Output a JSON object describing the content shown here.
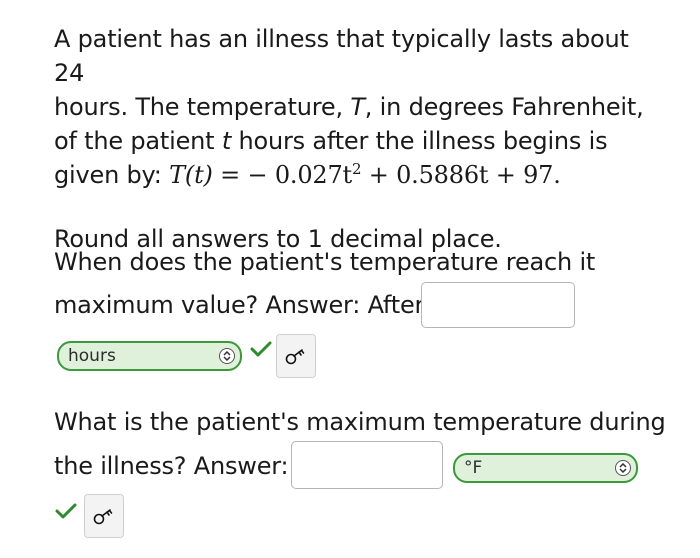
{
  "problem": {
    "line1": "A patient has an illness that typically lasts about 24",
    "line2": "hours. The temperature, ",
    "line2_var": "T",
    "line2_end": ", in degrees Fahrenheit,",
    "line3_start": "of the patient ",
    "line3_var": "t",
    "line3_end": " hours after the illness begins is",
    "line4_start": "given by: ",
    "formula_lhs": "T(t)",
    "formula_eq": " = ",
    "formula_part1": "− 0.027t",
    "formula_exp": "2",
    "formula_part2": " + 0.5886t + 97."
  },
  "instruction": "Round all answers to 1 decimal place.",
  "question1": {
    "line1": "When does the patient's temperature reach it",
    "line2": "maximum value? Answer: After",
    "answer_value": "",
    "unit_selected": "hours"
  },
  "question2": {
    "line1": "What is the patient's maximum temperature during",
    "line2": "the illness? Answer:",
    "answer_value": "",
    "unit_selected": "°F"
  },
  "colors": {
    "correct": "#2e8b2e",
    "select_bg": "#dff0db",
    "select_border": "#3a9a3a"
  },
  "icons": {
    "check": "check-icon",
    "key": "key-icon",
    "chevron": "chevron-updown-icon"
  }
}
